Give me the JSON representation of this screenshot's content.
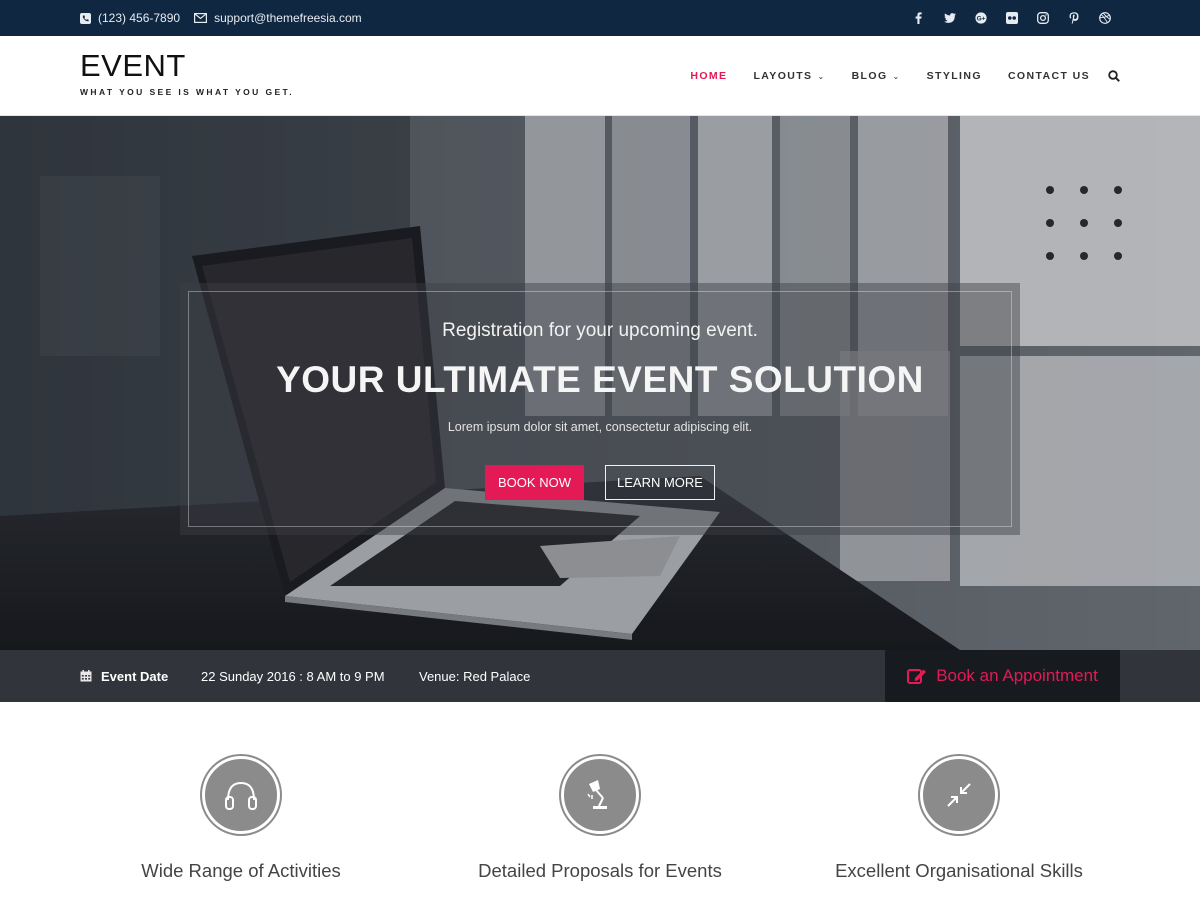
{
  "topbar": {
    "phone": "(123) 456-7890",
    "email": "support@themefreesia.com",
    "social": [
      "facebook-icon",
      "twitter-icon",
      "google-plus-icon",
      "flickr-icon",
      "instagram-icon",
      "pinterest-icon",
      "dribbble-icon"
    ]
  },
  "header": {
    "logo": "EVENT",
    "tagline": "WHAT YOU SEE IS WHAT YOU GET.",
    "nav": [
      {
        "label": "HOME",
        "active": true
      },
      {
        "label": "LAYOUTS",
        "dropdown": true
      },
      {
        "label": "BLOG",
        "dropdown": true
      },
      {
        "label": "STYLING"
      },
      {
        "label": "CONTACT US"
      }
    ]
  },
  "hero": {
    "subtitle": "Registration for your upcoming event.",
    "title": "YOUR ULTIMATE EVENT SOLUTION",
    "text": "Lorem ipsum dolor sit amet, consectetur adipiscing elit.",
    "primary_button": "BOOK NOW",
    "secondary_button": "LEARN MORE"
  },
  "event_bar": {
    "date_label": "Event Date",
    "date_value": "22 Sunday 2016 : 8 AM to 9 PM",
    "venue": "Venue: Red Palace",
    "appointment": "Book an Appointment"
  },
  "features": [
    {
      "title": "Wide Range of Activities",
      "icon": "headphones-icon"
    },
    {
      "title": "Detailed Proposals for Events",
      "icon": "desk-lamp-icon"
    },
    {
      "title": "Excellent Organisational Skills",
      "icon": "compress-arrows-icon"
    }
  ],
  "colors": {
    "accent": "#e31a56",
    "topbar": "#0f2741",
    "circle": "#8b8b8b"
  }
}
